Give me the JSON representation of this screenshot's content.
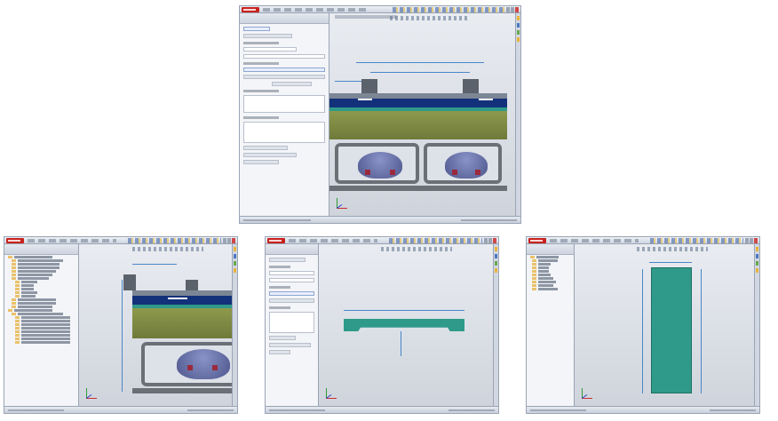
{
  "screenshots": [
    {
      "id": "main",
      "view": "assembly-dimension-closeup"
    },
    {
      "id": "bottom-left",
      "view": "assembly-with-feature-tree"
    },
    {
      "id": "bottom-middle",
      "view": "part-front-view"
    },
    {
      "id": "bottom-right",
      "view": "part-top-view"
    }
  ],
  "colors": {
    "steel_green": "#6f7a3a",
    "steel_green_light": "#8d9a4c",
    "navy_plate": "#13317a",
    "teal_part": "#2f9a8a",
    "gray_frame": "#6b6f77",
    "speaker_purple": "#6670a8",
    "magnet_red": "#9b2a3c",
    "dimension_blue": "#4a86c8"
  },
  "icons": [
    "app-logo-icon",
    "coordinate-axes-icon",
    "toolbar-icon",
    "task-pane-icon"
  ]
}
